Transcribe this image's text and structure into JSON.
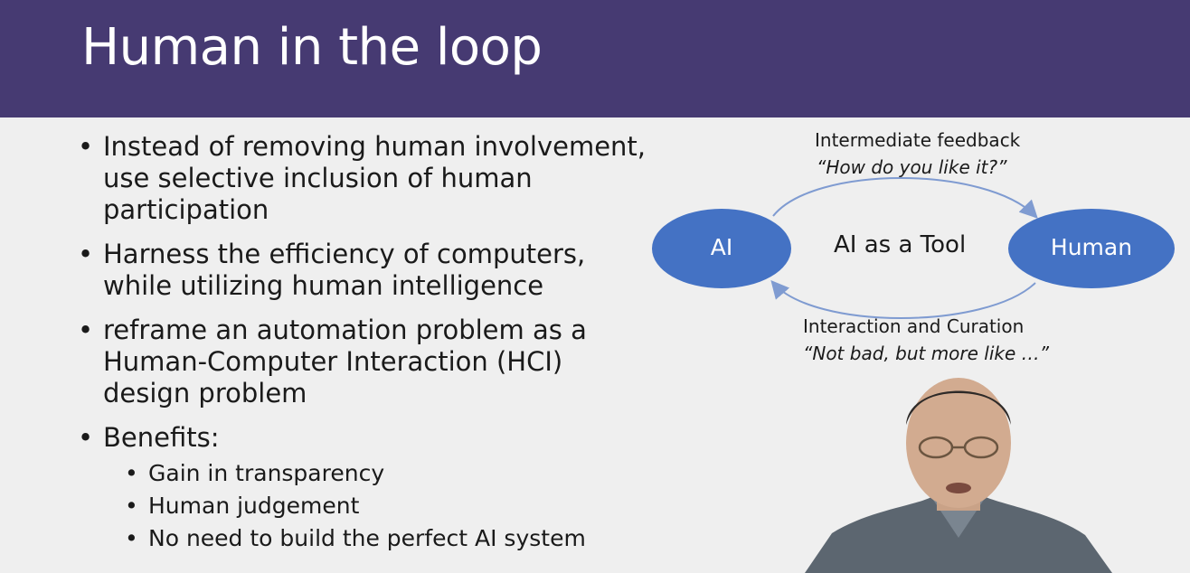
{
  "slide": {
    "title": "Human in the loop",
    "bullets": [
      "Instead of removing human involvement, use selective inclusion of human participation",
      "Harness the efficiency of computers, while utilizing human intelligence",
      "reframe an automation problem as a Human-Computer Interaction (HCI) design problem",
      "Benefits:"
    ],
    "sub_bullets": [
      "Gain in transparency",
      "Human judgement",
      "No need to build the perfect AI system"
    ]
  },
  "diagram": {
    "top_label": "Intermediate feedback",
    "top_quote": "“How do you like it?”",
    "left_node": "AI",
    "right_node": "Human",
    "center_label": "AI as a Tool",
    "bottom_label": "Interaction and Curation",
    "bottom_quote": "“Not bad, but more like …”"
  },
  "colors": {
    "title_bar": "#463a72",
    "node_fill": "#4472c4",
    "arrow": "#7f9bd1",
    "background": "#efefef"
  }
}
